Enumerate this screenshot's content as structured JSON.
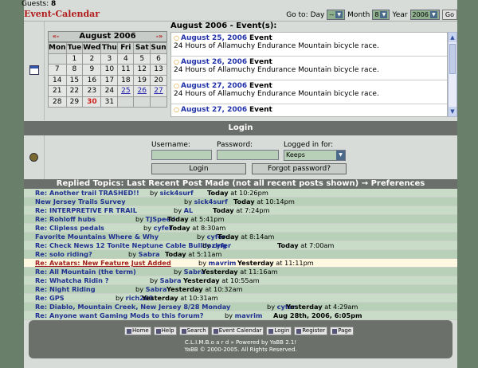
{
  "guests": {
    "label": "Guests:",
    "count": "8"
  },
  "calendar": {
    "title": "Event-Calendar",
    "goto_label": "Go to:",
    "day_label": "Day",
    "day_value": "--",
    "month_label": "Month",
    "month_value": "8",
    "year_label": "Year",
    "year_value": "2006",
    "go_button": "Go",
    "prev": "«-",
    "next": "-»",
    "month_name": "August 2006",
    "weekdays": [
      "Mon",
      "Tue",
      "Wed",
      "Thu",
      "Fri",
      "Sat",
      "Sun"
    ],
    "weeks": [
      [
        "",
        "1",
        "2",
        "3",
        "4",
        "5",
        "6"
      ],
      [
        "7",
        "8",
        "9",
        "10",
        "11",
        "12",
        "13"
      ],
      [
        "14",
        "15",
        "16",
        "17",
        "18",
        "19",
        "20"
      ],
      [
        "21",
        "22",
        "23",
        "24",
        "25",
        "26",
        "27"
      ],
      [
        "28",
        "29",
        "30",
        "31",
        "",
        "",
        ""
      ]
    ],
    "event_days": [
      "25",
      "26",
      "27"
    ],
    "today": "30",
    "events_title": "August 2006 - Event(s):",
    "events": [
      {
        "date": "August 25, 2006",
        "kind": "Event",
        "text": "24 Hours of Allamuchy Endurance Mountain bicycle race."
      },
      {
        "date": "August 26, 2006",
        "kind": "Event",
        "text": "24 Hours of Allamuchy Endurance Mountain bicycle race."
      },
      {
        "date": "August 27, 2006",
        "kind": "Event",
        "text": "24 Hours of Allamuchy Endurance Mountain bicycle race."
      },
      {
        "date": "August 27, 2006",
        "kind": "Event",
        "text": ""
      }
    ]
  },
  "login": {
    "title": "Login",
    "username_label": "Username:",
    "password_label": "Password:",
    "logged_label": "Logged in for:",
    "logged_value": "Keeps",
    "login_button": "Login",
    "forgot_button": "Forgot password?"
  },
  "replied": {
    "title": "Replied Topics: Last Recent Post Made (not all recent posts shown)",
    "arrow": "→",
    "prefs": "Preferences",
    "rows": [
      {
        "title": "Re: Another trail TRASHED!!",
        "by": "by",
        "author": "sick4surf",
        "day": "Today",
        "at": "at 10:26pm"
      },
      {
        "title": "New Jersey Trails Survey",
        "by": "by",
        "author": "sick4surf",
        "day": "Today",
        "at": "at 10:14pm"
      },
      {
        "title": "Re: INTERPRETIVE FR TRAIL",
        "by": "by",
        "author": "AL",
        "day": "Today",
        "at": "at 7:24pm"
      },
      {
        "title": "Re: Rohloff hubs",
        "by": "by",
        "author": "TJSpeed",
        "day": "Today",
        "at": "at 5:41pm"
      },
      {
        "title": "Re: Clipless pedals",
        "by": "by",
        "author": "cyfer",
        "day": "Today",
        "at": "at 8:30am"
      },
      {
        "title": "Favorite Mountains Where & Why",
        "by": "by",
        "author": "cyfer",
        "day": "Today",
        "at": "at 8:14am"
      },
      {
        "title": "Re: Check News 12 Tonite Neptune Cable Bulldozing",
        "by": "by",
        "author": "cyfer",
        "day": "Today",
        "at": "at 7:00am"
      },
      {
        "title": "Re: solo riding?",
        "by": "by",
        "author": "Sabra",
        "day": "Today",
        "at": "at 5:11am"
      },
      {
        "title": "Re: Avatars: New Feature Just Added",
        "by": "by",
        "author": "mavrim",
        "day": "Yesterday",
        "at": "at 11:11pm"
      },
      {
        "title": "Re: All Mountain (the term)",
        "by": "by",
        "author": "Sabra",
        "day": "Yesterday",
        "at": "at 11:16am"
      },
      {
        "title": "Re: Whatcha Ridin ?",
        "by": "by",
        "author": "Sabra",
        "day": "Yesterday",
        "at": "at 10:55am"
      },
      {
        "title": "Re: Night Riding",
        "by": "by",
        "author": "Sabra",
        "day": "Yesterday",
        "at": "at 10:32am"
      },
      {
        "title": "Re: GPS",
        "by": "by",
        "author": "rich280",
        "day": "Yesterday",
        "at": "at 10:31am"
      },
      {
        "title": "Re: Diablo, Mountain Creek, New Jersey 8/28 Monday",
        "by": "by",
        "author": "cyfer",
        "day": "Yesterday",
        "at": "at 4:29am"
      },
      {
        "title": "Re: Anyone want Gaming Mods to this forum?",
        "by": "by",
        "author": "mavrim",
        "day": "Aug 28th, 2006, 6:05pm",
        "at": ""
      }
    ]
  },
  "footer": {
    "buttons": [
      "Home",
      "Help",
      "Search",
      "Event Calendar",
      "Login",
      "Register",
      "Page"
    ],
    "line1": "C.L.I.M.B.o a r d » Powered by YaBB 2.1!",
    "line2": "YaBB © 2000-2005. All Rights Reserved."
  }
}
